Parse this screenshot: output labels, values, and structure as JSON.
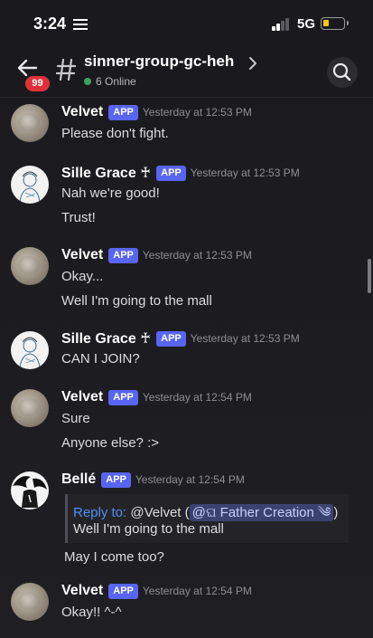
{
  "status_bar": {
    "time": "3:24",
    "network": "5G",
    "battery_level": 0.2,
    "signal_bars_active": 2
  },
  "header": {
    "unread_badge": "99",
    "channel_name": "sinner-group-gc-heh",
    "online_text": "6 Online"
  },
  "colors": {
    "accent": "#5865f2",
    "badge": "#e0313a",
    "online": "#3ba55d",
    "reply_link": "#4f8ef7"
  },
  "messages": [
    {
      "author": "Velvet",
      "tag": "APP",
      "time": "Yesterday at 12:53 PM",
      "lines": [
        "Please don't fight."
      ]
    },
    {
      "author": "Sille Grace ♰",
      "tag": "APP",
      "time": "Yesterday at 12:53 PM",
      "lines": [
        "Nah we're good!",
        "Trust!"
      ]
    },
    {
      "author": "Velvet",
      "tag": "APP",
      "time": "Yesterday at 12:53 PM",
      "lines": [
        "Okay...",
        "Well I'm going to the mall"
      ]
    },
    {
      "author": "Sille Grace ♰",
      "tag": "APP",
      "time": "Yesterday at 12:53 PM",
      "lines": [
        "CAN I JOIN?"
      ]
    },
    {
      "author": "Velvet",
      "tag": "APP",
      "time": "Yesterday at 12:54 PM",
      "lines": [
        "Sure",
        "Anyone else? :>"
      ]
    },
    {
      "author": "Bellé",
      "tag": "APP",
      "time": "Yesterday at 12:54 PM",
      "reply": {
        "label": "Reply to:",
        "target": " @Velvet (",
        "mention": "@ଘ Father Creation ༄",
        "close": ")",
        "quoted": "Well I'm going to the mall"
      },
      "lines": [
        "May I come too?"
      ]
    },
    {
      "author": "Velvet",
      "tag": "APP",
      "time": "Yesterday at 12:54 PM",
      "lines": [
        "Okay!! ^-^"
      ]
    }
  ]
}
